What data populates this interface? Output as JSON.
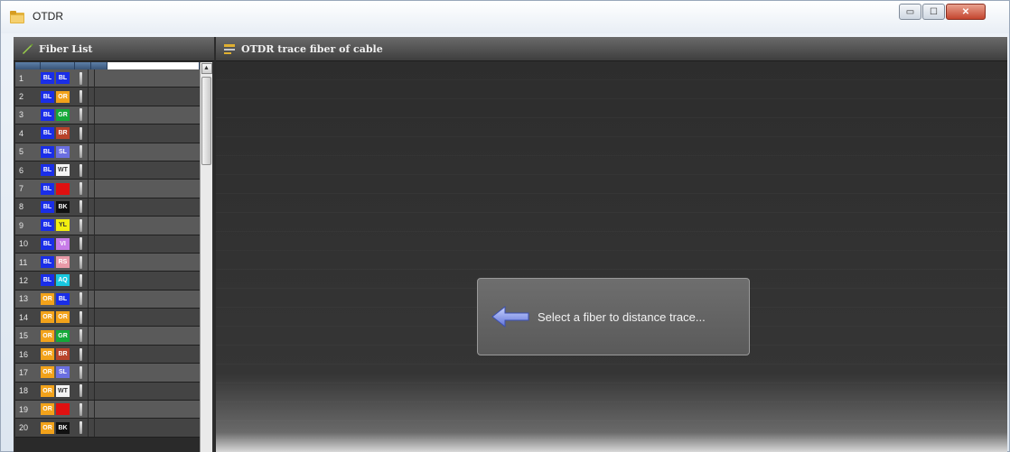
{
  "window": {
    "title": "OTDR",
    "icon": "folder-app-icon",
    "controls": [
      "minimize",
      "maximize",
      "close"
    ]
  },
  "fiber_list": {
    "title": "Fiber List",
    "header_icon": "pencil-icon",
    "rows": [
      {
        "num": "1",
        "c1": "BL",
        "c2": "BL"
      },
      {
        "num": "2",
        "c1": "BL",
        "c2": "OR"
      },
      {
        "num": "3",
        "c1": "BL",
        "c2": "GR"
      },
      {
        "num": "4",
        "c1": "BL",
        "c2": "BR"
      },
      {
        "num": "5",
        "c1": "BL",
        "c2": "SL"
      },
      {
        "num": "6",
        "c1": "BL",
        "c2": "WT"
      },
      {
        "num": "7",
        "c1": "BL",
        "c2": "RD"
      },
      {
        "num": "8",
        "c1": "BL",
        "c2": "BK"
      },
      {
        "num": "9",
        "c1": "BL",
        "c2": "YL"
      },
      {
        "num": "10",
        "c1": "BL",
        "c2": "VI"
      },
      {
        "num": "11",
        "c1": "BL",
        "c2": "RS"
      },
      {
        "num": "12",
        "c1": "BL",
        "c2": "AQ"
      },
      {
        "num": "13",
        "c1": "OR",
        "c2": "BL"
      },
      {
        "num": "14",
        "c1": "OR",
        "c2": "OR"
      },
      {
        "num": "15",
        "c1": "OR",
        "c2": "GR"
      },
      {
        "num": "16",
        "c1": "OR",
        "c2": "BR"
      },
      {
        "num": "17",
        "c1": "OR",
        "c2": "SL"
      },
      {
        "num": "18",
        "c1": "OR",
        "c2": "WT"
      },
      {
        "num": "19",
        "c1": "OR",
        "c2": "RD"
      },
      {
        "num": "20",
        "c1": "OR",
        "c2": "BK"
      }
    ]
  },
  "trace_panel": {
    "title": "OTDR trace fiber  of cable",
    "header_icon": "trace-icon",
    "hint": "Select a fiber to distance trace..."
  },
  "colors": {
    "BL": {
      "bg": "#1a2ee8",
      "fg": "#ffffff"
    },
    "OR": {
      "bg": "#f2a21a",
      "fg": "#ffffff"
    },
    "GR": {
      "bg": "#14a838",
      "fg": "#ffffff"
    },
    "BR": {
      "bg": "#b8432b",
      "fg": "#ffffff"
    },
    "SL": {
      "bg": "#6b6fe0",
      "fg": "#ffffff"
    },
    "WT": {
      "bg": "#f4f4f4",
      "fg": "#333333"
    },
    "RD": {
      "bg": "#e01010",
      "fg": "#e01010"
    },
    "BK": {
      "bg": "#111111",
      "fg": "#ffffff"
    },
    "YL": {
      "bg": "#f2ee10",
      "fg": "#333333"
    },
    "VI": {
      "bg": "#c77be8",
      "fg": "#ffffff"
    },
    "RS": {
      "bg": "#e89aa8",
      "fg": "#ffffff"
    },
    "AQ": {
      "bg": "#18c8e0",
      "fg": "#ffffff"
    }
  }
}
